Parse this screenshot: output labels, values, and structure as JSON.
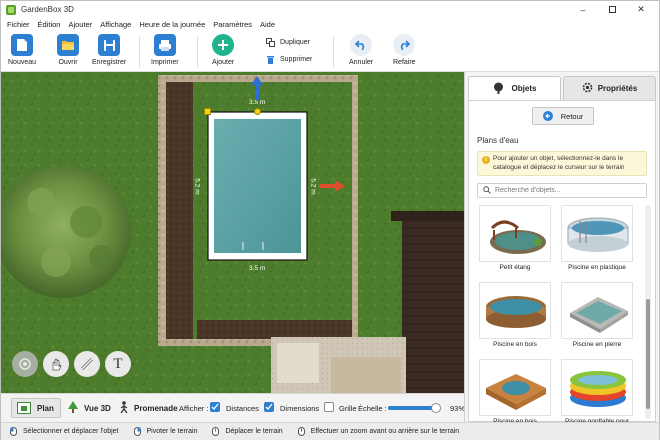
{
  "window": {
    "title": "GardenBox 3D"
  },
  "menu": [
    "Fichier",
    "Édition",
    "Ajouter",
    "Affichage",
    "Heure de la journée",
    "Paramètres",
    "Aide"
  ],
  "toolbar": {
    "new": "Nouveau",
    "open": "Ouvrir",
    "save": "Enregistrer",
    "print": "Imprimer",
    "add": "Ajouter",
    "duplicate": "Dupliquer",
    "delete": "Supprimer",
    "undo": "Annuler",
    "redo": "Refaire"
  },
  "canvas": {
    "pool_width_label": "3.5 m",
    "pool_width_label_bottom": "3.5 m",
    "pool_length_label": "5.2 m",
    "pool_length_label_left": "5.2 m",
    "text_tool_label": "T"
  },
  "view": {
    "plan": "Plan",
    "view3d": "Vue 3D",
    "walk": "Promenade",
    "show_label": "Afficher :",
    "distances": "Distances",
    "distances_checked": true,
    "dimensions": "Dimensions",
    "dimensions_checked": true,
    "grid": "Grille",
    "grid_checked": false,
    "scale_label": "Échelle :",
    "scale_value": "93%",
    "scale_fraction": 0.93
  },
  "panel": {
    "tab_objects": "Objets",
    "tab_properties": "Propriétés",
    "back": "Retour",
    "section": "Plans d'eau",
    "hint": "Pour ajouter un objet, sélectionnez-le dans le catalogue et déplacez le curseur sur le terrain",
    "search_placeholder": "Recherche d'objets...",
    "items": [
      "Petit étang",
      "Piscine en plastique",
      "Piscine en bois",
      "Piscine en pierre",
      "Piscine en bois",
      "Piscine gonflable pour enfants"
    ]
  },
  "status": {
    "select": "Sélectionner et déplacer l'objet",
    "rotate": "Pivoter le terrain",
    "move": "Déplacer le terrain",
    "zoom": "Effectuer un zoom avant ou arrière sur le terrain"
  },
  "colors": {
    "accent": "#2d7fd1",
    "grass": "#4a7a2a",
    "soil": "#4a3424",
    "pool": "#5fa4a4"
  }
}
